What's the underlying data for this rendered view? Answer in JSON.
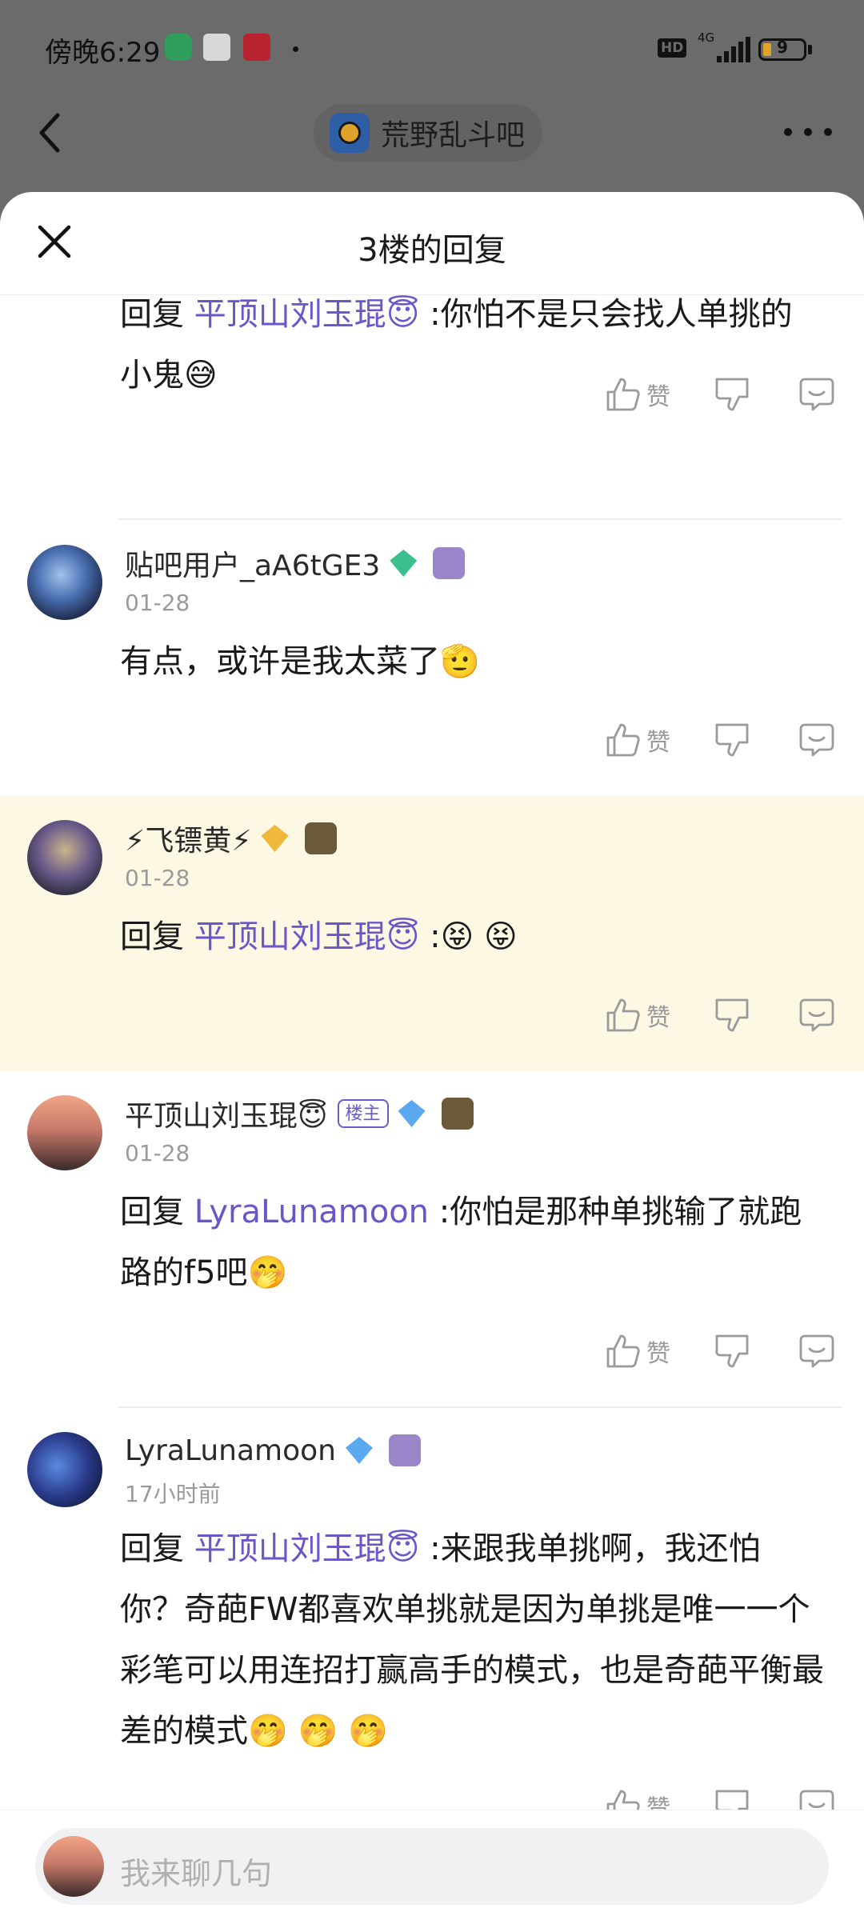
{
  "status_bar": {
    "time": "傍晚6:29",
    "network": "4G",
    "hd": "HD",
    "battery": "9"
  },
  "nav": {
    "forum_name": "荒野乱斗吧"
  },
  "sheet": {
    "title": "3楼的回复"
  },
  "like_label": "赞",
  "replies": [
    {
      "prefix": "回复 ",
      "mention": "平顶山刘玉琨😇",
      "text": " :你怕不是只会找人单挑的小鬼😅"
    },
    {
      "username": "贴吧用户_aA6tGE3",
      "gem_level": "1",
      "date": "01-28",
      "text": "有点，或许是我太菜了🫡"
    },
    {
      "username": "⚡飞镖黄⚡",
      "gem_level": "11",
      "date": "01-28",
      "prefix": "回复 ",
      "mention": "平顶山刘玉琨😇",
      "text": " :😝 😝",
      "highlighted": true
    },
    {
      "username": "平顶山刘玉琨😇",
      "owner_tag": "楼主",
      "gem_level": "4",
      "date": "01-28",
      "prefix": "回复 ",
      "mention": "LyraLunamoon",
      "text": " :你怕是那种单挑输了就跑路的f5吧🤭"
    },
    {
      "username": "LyraLunamoon",
      "gem_level": "6",
      "date": "17小时前",
      "prefix": "回复 ",
      "mention": "平顶山刘玉琨😇",
      "text": " :来跟我单挑啊，我还怕你？奇葩FW都喜欢单挑就是因为单挑是唯一一个彩笔可以用连招打赢高手的模式，也是奇葩平衡最差的模式🤭 🤭 🤭"
    }
  ],
  "input": {
    "placeholder": "我来聊几句"
  },
  "colors": {
    "mention": "#6a55c9",
    "highlight_bg": "#fdf8e4",
    "overlay": "#6b6b6b",
    "owner_tag": "#6a5acd"
  },
  "icons": [
    "back-icon",
    "more-icon",
    "close-icon",
    "thumbs-up-icon",
    "thumbs-down-icon",
    "reply-bubble-icon",
    "gem-badge-icon",
    "level-badge-icon"
  ]
}
